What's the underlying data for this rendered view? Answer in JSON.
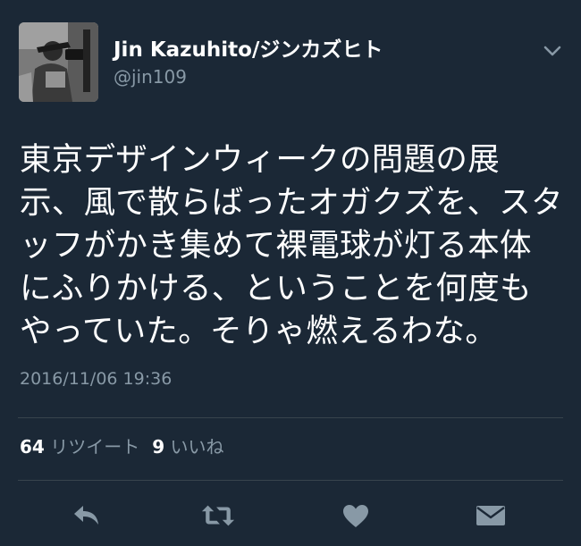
{
  "user": {
    "display_name": "Jin Kazuhito/ジンカズヒト",
    "handle": "@jin109"
  },
  "tweet": {
    "text": "東京デザインウィークの問題の展示、風で散らばったオガクズを、スタッフがかき集めて裸電球が灯る本体にふりかける、ということを何度もやっていた。そりゃ燃えるわな。",
    "timestamp": "2016/11/06 19:36"
  },
  "stats": {
    "retweet_count": "64",
    "retweet_label": "リツイート",
    "like_count": "9",
    "like_label": "いいね"
  },
  "actions": [
    {
      "icon": "reply-icon"
    },
    {
      "icon": "retweet-icon"
    },
    {
      "icon": "heart-icon"
    },
    {
      "icon": "direct-message-icon"
    }
  ],
  "colors": {
    "background": "#1b2836",
    "text": "#ffffff",
    "secondary_text": "#8899a6",
    "icon": "#8899a6",
    "divider": "#38444d"
  }
}
